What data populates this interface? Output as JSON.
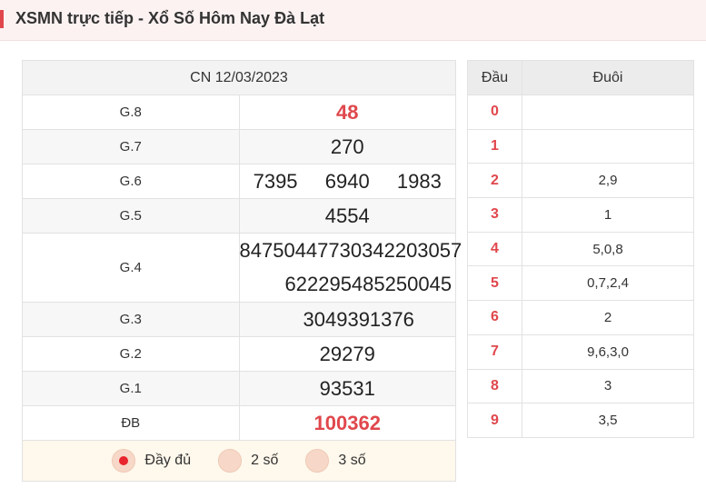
{
  "header": {
    "title": "XSMN trực tiếp - Xổ Số Hôm Nay Đà Lạt",
    "accent_color": "#e0474c"
  },
  "results": {
    "date": "CN 12/03/2023",
    "prizes": [
      {
        "label": "G.8",
        "numbers": [
          "48"
        ]
      },
      {
        "label": "G.7",
        "numbers": [
          "270"
        ]
      },
      {
        "label": "G.6",
        "numbers": [
          "7395",
          "6940",
          "1983"
        ]
      },
      {
        "label": "G.5",
        "numbers": [
          "4554"
        ]
      },
      {
        "label": "G.4",
        "numbers": [
          "84750",
          "44773",
          "03422",
          "03057",
          "62229",
          "54852",
          "50045"
        ]
      },
      {
        "label": "G.3",
        "numbers": [
          "30493",
          "91376"
        ]
      },
      {
        "label": "G.2",
        "numbers": [
          "29279"
        ]
      },
      {
        "label": "G.1",
        "numbers": [
          "93531"
        ]
      },
      {
        "label": "ĐB",
        "numbers": [
          "100362"
        ]
      }
    ],
    "options": [
      {
        "label": "Đầy đủ",
        "selected": true
      },
      {
        "label": "2 số",
        "selected": false
      },
      {
        "label": "3 số",
        "selected": false
      }
    ]
  },
  "loto": {
    "header_dau": "Đầu",
    "header_duoi": "Đuôi",
    "rows": [
      {
        "dau": "0",
        "duoi": ""
      },
      {
        "dau": "1",
        "duoi": ""
      },
      {
        "dau": "2",
        "duoi": "2,9"
      },
      {
        "dau": "3",
        "duoi": "1"
      },
      {
        "dau": "4",
        "duoi": "5,0,8"
      },
      {
        "dau": "5",
        "duoi": "0,7,2,4"
      },
      {
        "dau": "6",
        "duoi": "2"
      },
      {
        "dau": "7",
        "duoi": "9,6,3,0"
      },
      {
        "dau": "8",
        "duoi": "3"
      },
      {
        "dau": "9",
        "duoi": "3,5"
      }
    ]
  }
}
